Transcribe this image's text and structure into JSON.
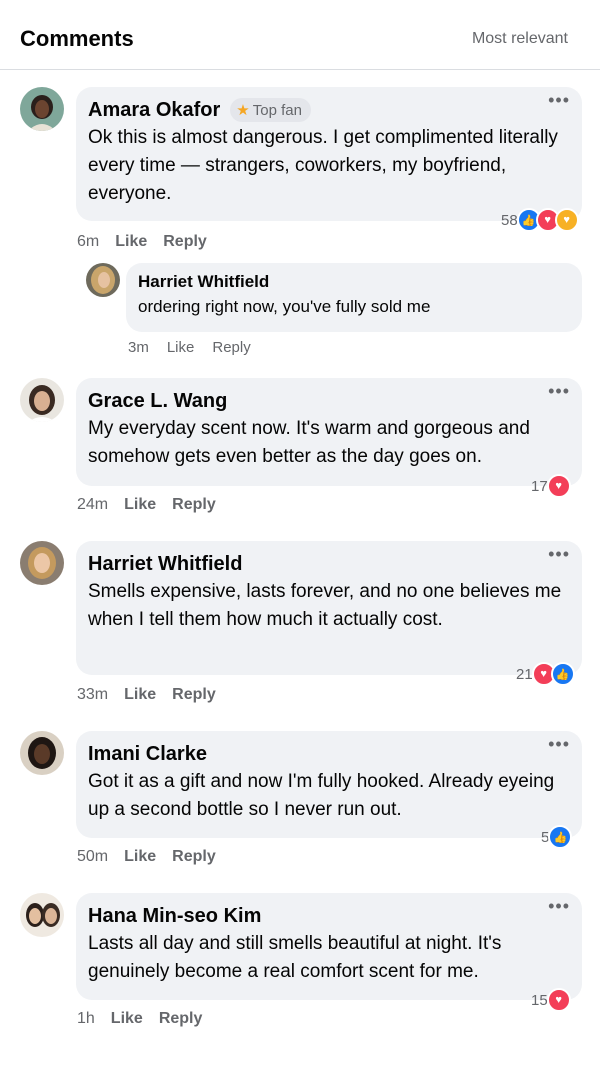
{
  "header": {
    "title": "Comments",
    "sort": "Most relevant"
  },
  "comments": [
    {
      "name": "Amara Okafor",
      "badge": "Top fan",
      "text": "Ok this is almost dangerous. I get complimented literally every time — strangers, coworkers, my boyfriend, everyone.",
      "reaction_count": "58",
      "time": "6m",
      "like": "Like",
      "reply": "Reply"
    },
    {
      "name": "Grace L. Wang",
      "text": "My everyday scent now. It's warm and gorgeous and somehow gets even better as the day goes on.",
      "reaction_count": "17",
      "time": "24m",
      "like": "Like",
      "reply": "Reply"
    },
    {
      "name": "Harriet Whitfield",
      "text": "Smells expensive, lasts forever, and no one believes me when I tell them how much it actually cost.",
      "reaction_count": "21",
      "time": "33m",
      "like": "Like",
      "reply": "Reply"
    },
    {
      "name": "Imani Clarke",
      "text": "Got it as a gift and now I'm fully hooked. Already eyeing up a second bottle so I never run out.",
      "reaction_count": "5",
      "time": "50m",
      "like": "Like",
      "reply": "Reply"
    },
    {
      "name": "Hana Min-seo Kim",
      "text": "Lasts all day and still smells beautiful at night. It's genuinely become a real comfort scent for me.",
      "reaction_count": "15",
      "time": "1h",
      "like": "Like",
      "reply": "Reply"
    }
  ],
  "reply": {
    "name": "Harriet Whitfield",
    "text": "ordering right now, you've fully sold me",
    "time": "3m",
    "like": "Like",
    "reply": "Reply"
  },
  "more_glyph": "•••",
  "icons": {
    "like": "like-reaction-icon",
    "love": "love-reaction-icon",
    "care": "care-reaction-icon",
    "star": "star-icon",
    "more": "more-options-icon"
  },
  "colors": {
    "like": "#1877f2",
    "love": "#f33e58",
    "care": "#f7b125",
    "bubble": "#f0f2f5",
    "secondary_text": "#65676b"
  }
}
